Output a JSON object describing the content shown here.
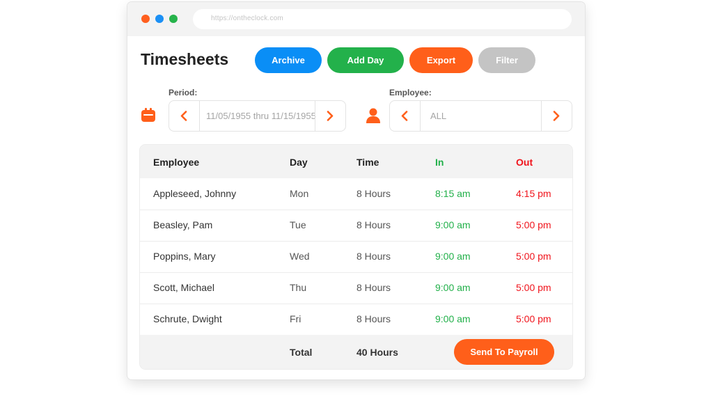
{
  "browser": {
    "url": "https://ontheclock.com"
  },
  "page": {
    "title": "Timesheets"
  },
  "toolbar": {
    "archive_label": "Archive",
    "add_day_label": "Add Day",
    "export_label": "Export",
    "filter_label": "Filter"
  },
  "filters": {
    "period_label": "Period:",
    "period_value": "11/05/1955 thru 11/15/1955",
    "employee_label": "Employee:",
    "employee_value": "ALL"
  },
  "icons": {
    "period": "calendar-icon",
    "employee": "person-icon",
    "prev": "chevron-left-icon",
    "next": "chevron-right-icon"
  },
  "colors": {
    "accent": "#ff5f1a",
    "archive": "#0a8ef6",
    "add_day": "#23b14b",
    "filter": "#c4c4c4",
    "in_time": "#22b04a",
    "out_time": "#f0141c"
  },
  "table": {
    "headers": {
      "employee": "Employee",
      "day": "Day",
      "time": "Time",
      "in": "In",
      "out": "Out"
    },
    "rows": [
      {
        "employee": "Appleseed, Johnny",
        "day": "Mon",
        "time": "8 Hours",
        "in": "8:15 am",
        "out": "4:15 pm"
      },
      {
        "employee": "Beasley, Pam",
        "day": "Tue",
        "time": "8 Hours",
        "in": "9:00 am",
        "out": "5:00 pm"
      },
      {
        "employee": "Poppins, Mary",
        "day": "Wed",
        "time": "8 Hours",
        "in": "9:00 am",
        "out": "5:00 pm"
      },
      {
        "employee": "Scott, Michael",
        "day": "Thu",
        "time": "8 Hours",
        "in": "9:00 am",
        "out": "5:00 pm"
      },
      {
        "employee": "Schrute, Dwight",
        "day": "Fri",
        "time": "8 Hours",
        "in": "9:00 am",
        "out": "5:00 pm"
      }
    ],
    "footer": {
      "total_label": "Total",
      "total_value": "40 Hours",
      "send_label": "Send To Payroll"
    }
  }
}
